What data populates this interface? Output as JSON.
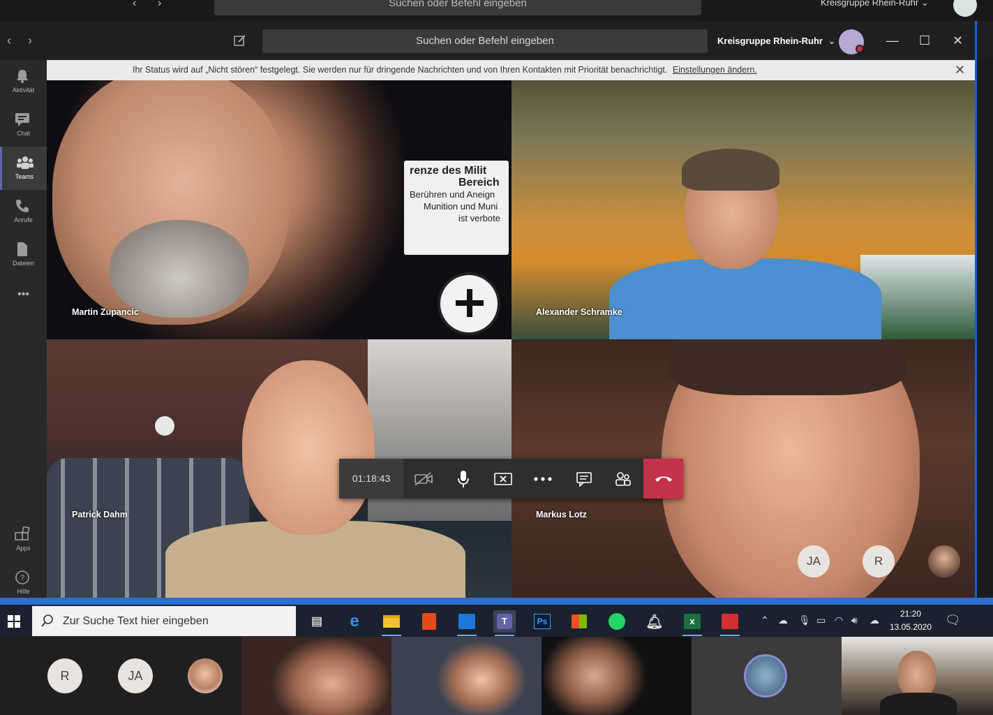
{
  "ghost_window": {
    "search_text": "Suchen oder Befehl eingeben",
    "org_label": "Kreisgruppe Rhein-Ruhr ⌄"
  },
  "window": {
    "search_placeholder": "Suchen oder Befehl eingeben",
    "org_label": "Kreisgruppe Rhein-Ruhr",
    "org_chevron": "⌄",
    "minimize": "—",
    "maximize": "☐",
    "close": "✕"
  },
  "rail": {
    "items": [
      {
        "label": "Aktivität",
        "icon": "bell-icon"
      },
      {
        "label": "Chat",
        "icon": "chat-icon"
      },
      {
        "label": "Teams",
        "icon": "teams-icon"
      },
      {
        "label": "Anrufe",
        "icon": "phone-icon"
      },
      {
        "label": "Dateien",
        "icon": "file-icon"
      },
      {
        "label": "Apps",
        "icon": "apps-icon"
      },
      {
        "label": "Hilfe",
        "icon": "help-icon"
      }
    ],
    "more": "•••",
    "active": "Teams"
  },
  "banner": {
    "text": "Ihr Status wird auf „Nicht stören“ festgelegt. Sie werden nur für dringende Nachrichten und von Ihren Kontakten mit Priorität benachrichtigt.",
    "link": "Einstellungen ändern.",
    "close": "✕"
  },
  "participants": [
    {
      "name": "Martin Zupancic"
    },
    {
      "name": "Alexander Schramke"
    },
    {
      "name": "Patrick Dahm"
    },
    {
      "name": "Markus Lotz"
    }
  ],
  "sign_text": {
    "line1": "renze des Milit",
    "line2": "Bereich",
    "line3": "Berühren und Aneign",
    "line4": "Munition und Muni",
    "line5": "ist verbote"
  },
  "call": {
    "timer": "01:18:43",
    "buttons": [
      "camera-off-icon",
      "microphone-icon",
      "stop-share-icon",
      "more-icon",
      "chat-icon",
      "participants-icon",
      "hangup-icon"
    ]
  },
  "stage_avatars": [
    "JA",
    "R"
  ],
  "taskbar": {
    "search_placeholder": "Zur Suche Text hier eingeben",
    "time": "21:20",
    "date": "13.05.2020",
    "apps": [
      "scanner-icon",
      "edge-icon",
      "explorer-icon",
      "office-icon",
      "outlook-icon",
      "teams-icon",
      "photoshop-icon",
      "store-icon",
      "whatsapp-icon",
      "bell-app-icon",
      "excel-icon",
      "acrobat-icon"
    ],
    "ps_label": "Ps"
  },
  "strip": {
    "avatars": [
      "R",
      "JA"
    ]
  },
  "colors": {
    "accent": "#6264a7",
    "hangup": "#c4314b",
    "taskbar": "#1a2230"
  }
}
